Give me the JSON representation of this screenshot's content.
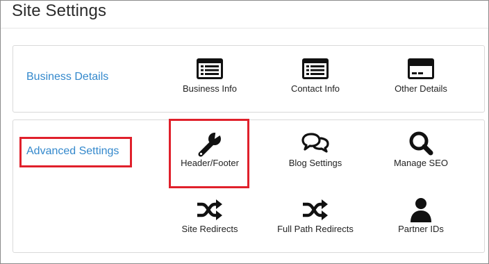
{
  "page": {
    "title": "Site Settings"
  },
  "sections": [
    {
      "label": "Business Details",
      "items": [
        {
          "label": "Business Info",
          "icon": "list-card-icon"
        },
        {
          "label": "Contact Info",
          "icon": "list-card-icon"
        },
        {
          "label": "Other Details",
          "icon": "credit-card-icon"
        }
      ]
    },
    {
      "label": "Advanced Settings",
      "items": [
        {
          "label": "Header/Footer",
          "icon": "wrench-icon"
        },
        {
          "label": "Blog Settings",
          "icon": "chat-bubbles-icon"
        },
        {
          "label": "Manage SEO",
          "icon": "search-icon"
        },
        {
          "label": "Site Redirects",
          "icon": "shuffle-icon"
        },
        {
          "label": "Full Path Redirects",
          "icon": "shuffle-icon"
        },
        {
          "label": "Partner IDs",
          "icon": "user-icon"
        }
      ]
    }
  ],
  "colors": {
    "link": "#3388cc",
    "highlight": "#e0202b",
    "icon": "#111111"
  }
}
